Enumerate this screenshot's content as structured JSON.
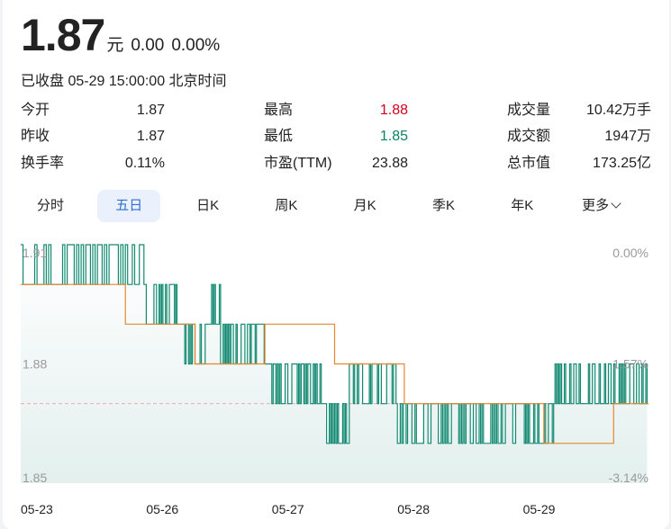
{
  "quote": {
    "price": "1.87",
    "unit": "元",
    "change": "0.00",
    "change_pct": "0.00%",
    "status": "已收盘 05-29 15:00:00 北京时间"
  },
  "stats": [
    {
      "label": "今开",
      "value": "1.87",
      "color": ""
    },
    {
      "label": "最高",
      "value": "1.88",
      "color": "red"
    },
    {
      "label": "成交量",
      "value": "10.42万手",
      "color": ""
    },
    {
      "label": "昨收",
      "value": "1.87",
      "color": ""
    },
    {
      "label": "最低",
      "value": "1.85",
      "color": "green"
    },
    {
      "label": "成交额",
      "value": "1947万",
      "color": ""
    },
    {
      "label": "换手率",
      "value": "0.11%",
      "color": ""
    },
    {
      "label": "市盈(TTM)",
      "value": "23.88",
      "color": ""
    },
    {
      "label": "总市值",
      "value": "173.25亿",
      "color": ""
    }
  ],
  "tabs": [
    {
      "label": "分时",
      "active": false
    },
    {
      "label": "五日",
      "active": true
    },
    {
      "label": "日K",
      "active": false
    },
    {
      "label": "周K",
      "active": false
    },
    {
      "label": "月K",
      "active": false
    },
    {
      "label": "季K",
      "active": false
    },
    {
      "label": "年K",
      "active": false
    },
    {
      "label": "更多",
      "active": false
    }
  ],
  "colors": {
    "price_line": "#138a72",
    "avg_line": "#e8862a",
    "prev_close_line": "#f4a8b0",
    "fill_top": "#ffffff",
    "fill_bottom": "#e3f0ee"
  },
  "chart_data": {
    "type": "line",
    "x": [
      "05-23",
      "05-26",
      "05-27",
      "05-28",
      "05-29"
    ],
    "ylim": [
      1.85,
      1.91
    ],
    "prev_close": 1.87,
    "y_left_ticks": [
      "1.91",
      "1.88",
      "1.85"
    ],
    "y_right_ticks": [
      "0.00%",
      "1.57%",
      "-3.14%"
    ],
    "series": [
      {
        "days": [
          {
            "day": "05-23",
            "segments": [
              {
                "base": 1.9,
                "alt": 1.91,
                "n": 14
              },
              {
                "base": 1.9,
                "alt": 1.89,
                "n": 4
              },
              {
                "base": 1.9,
                "alt": 1.91,
                "n": 36
              }
            ]
          },
          {
            "day": "05-26",
            "segments": [
              {
                "base": 1.89,
                "alt": 1.9,
                "n": 30
              },
              {
                "base": 1.88,
                "alt": 1.89,
                "n": 20
              },
              {
                "base": 1.89,
                "alt": 1.9,
                "n": 8
              },
              {
                "base": 1.89,
                "alt": 1.88,
                "n": 40
              }
            ]
          },
          {
            "day": "05-27",
            "segments": [
              {
                "base": 1.88,
                "alt": 1.87,
                "n": 40
              },
              {
                "base": 1.87,
                "alt": 1.86,
                "n": 18
              },
              {
                "base": 1.87,
                "alt": 1.88,
                "n": 36
              }
            ]
          },
          {
            "day": "05-28",
            "segments": [
              {
                "base": 1.87,
                "alt": 1.86,
                "n": 60
              },
              {
                "base": 1.87,
                "alt": 1.86,
                "n": 26
              }
            ]
          },
          {
            "day": "05-29",
            "segments": [
              {
                "base": 1.86,
                "alt": 1.87,
                "n": 24
              },
              {
                "base": 1.87,
                "alt": 1.88,
                "n": 70
              }
            ]
          }
        ]
      },
      {
        "avg": [
          [
            1.9,
            1.9
          ],
          [
            1.9,
            1.89
          ],
          [
            1.89,
            1.88
          ],
          [
            1.88,
            1.89
          ],
          [
            1.89,
            1.88
          ],
          [
            1.88,
            1.87
          ],
          [
            1.87,
            1.87
          ],
          [
            1.87,
            1.86
          ],
          [
            1.86,
            1.87
          ]
        ]
      }
    ]
  }
}
